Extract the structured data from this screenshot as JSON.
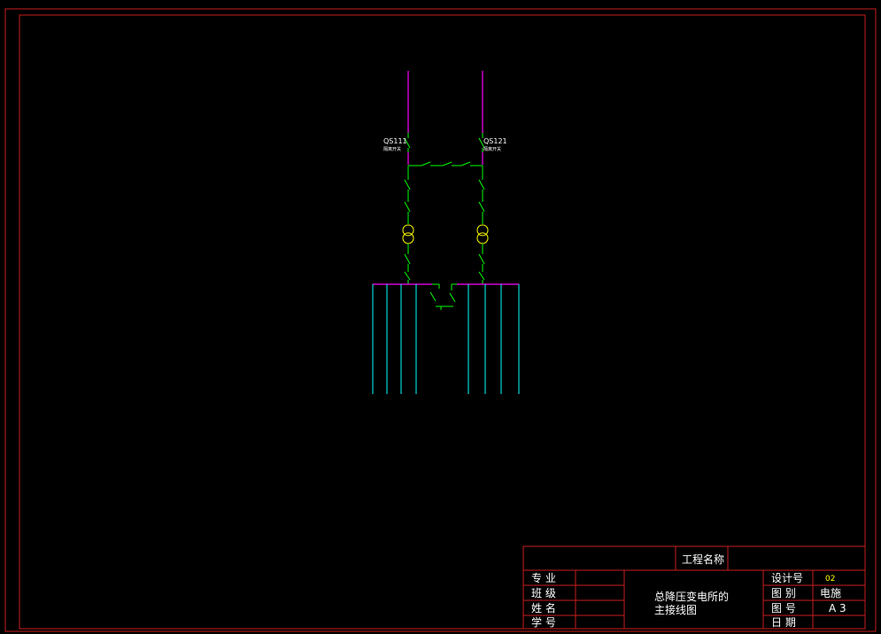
{
  "colors": {
    "background": "#000000",
    "frame": "#c81e1e",
    "bus": "#ff00ff",
    "switch": "#00ff00",
    "transformer": "#ffff00",
    "feeder": "#00ffff"
  },
  "diagram": {
    "left_switch": {
      "id": "QS111",
      "note": "隔离开关"
    },
    "right_switch": {
      "id": "QS121",
      "note": "隔离开关"
    }
  },
  "title_block": {
    "project_name_label": "工程名称",
    "left_rows": [
      "专  业",
      "班  级",
      "姓  名",
      "学  号"
    ],
    "drawing_title_line1": "总降压变电所的",
    "drawing_title_line2": "主接线图",
    "right_labels": [
      "设计号",
      "图  别",
      "图  号",
      "日  期"
    ],
    "right_values": [
      "02",
      "电施",
      "A 3",
      ""
    ]
  }
}
